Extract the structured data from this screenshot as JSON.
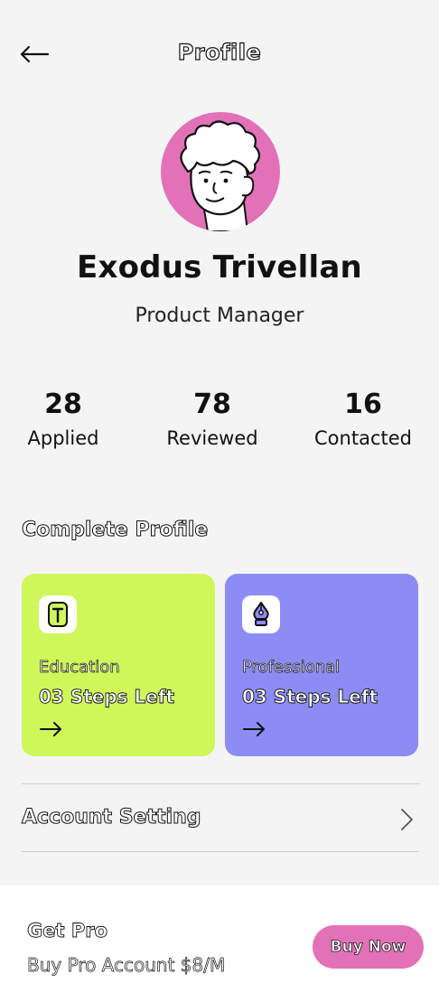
{
  "header": {
    "title": "Profile"
  },
  "profile": {
    "name": "Exodus Trivellan",
    "role": "Product Manager",
    "avatar_color": "#e271b8"
  },
  "stats": [
    {
      "value": "28",
      "label": "Applied"
    },
    {
      "value": "78",
      "label": "Reviewed"
    },
    {
      "value": "16",
      "label": "Contacted"
    }
  ],
  "complete_profile": {
    "title": "Complete Profile",
    "cards": [
      {
        "label": "Education",
        "steps": "03 Steps Left",
        "icon": "education-icon",
        "color": "#cff75a"
      },
      {
        "label": "Professional",
        "steps": "03 Steps Left",
        "icon": "pen-nib-icon",
        "color": "#8c8cf4"
      }
    ]
  },
  "settings": {
    "account_label": "Account Setting"
  },
  "pro_banner": {
    "title": "Get Pro",
    "subtitle": "Buy Pro Account $8/M",
    "button_label": "Buy Now",
    "button_color": "#e271b8"
  }
}
